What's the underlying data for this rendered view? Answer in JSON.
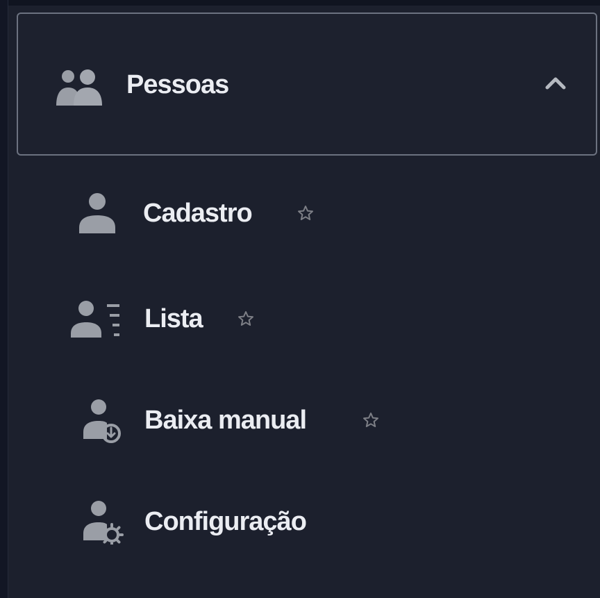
{
  "menu": {
    "header": {
      "label": "Pessoas",
      "icon": "people-icon",
      "expanded": true,
      "toggle_icon": "chevron-up-icon"
    },
    "items": [
      {
        "label": "Cadastro",
        "icon": "person-icon",
        "favorite": false,
        "favorite_icon": "star-outline-icon"
      },
      {
        "label": "Lista",
        "icon": "person-list-icon",
        "favorite": false,
        "favorite_icon": "star-outline-icon"
      },
      {
        "label": "Baixa manual",
        "icon": "person-download-icon",
        "favorite": false,
        "favorite_icon": "star-outline-icon"
      },
      {
        "label": "Configuração",
        "icon": "person-gear-icon"
      }
    ]
  },
  "colors": {
    "background": "#1c202d",
    "text": "#ebedf2",
    "icon": "#9a9ea6",
    "border": "#6c7280",
    "star": "#7d7f86"
  }
}
